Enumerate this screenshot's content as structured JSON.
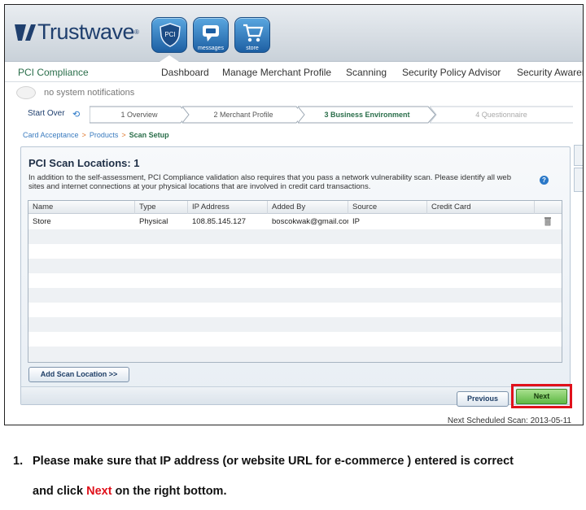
{
  "header": {
    "brand": "Trustwave",
    "brand_mark": "®",
    "pci_label": "PCI",
    "messages_label": "messages",
    "store_label": "store"
  },
  "nav": {
    "title": "PCI Compliance",
    "items": [
      "Dashboard",
      "Manage Merchant Profile",
      "Scanning",
      "Security Policy Advisor",
      "Security Awarer"
    ]
  },
  "notifications": "no system notifications",
  "wizard": {
    "start_over": "Start Over",
    "steps": [
      {
        "label": "1  Overview",
        "state": "done"
      },
      {
        "label": "2  Merchant Profile",
        "state": "done"
      },
      {
        "label": "3  Business Environment",
        "state": "active"
      },
      {
        "label": "4  Questionnaire",
        "state": "disabled"
      }
    ]
  },
  "breadcrumb": {
    "items": [
      "Card Acceptance",
      "Products"
    ],
    "current": "Scan Setup",
    "separator": ">"
  },
  "panel": {
    "title": "PCI Scan Locations: 1",
    "description": "In addition to the self-assessment, PCI Compliance validation also requires that you pass a network vulnerability scan.  Please identify all web sites and internet connections at your physical locations that are involved in credit card transactions.",
    "help": "?"
  },
  "grid": {
    "columns": [
      "Name",
      "Type",
      "IP Address",
      "Added By",
      "Source",
      "Credit Card"
    ],
    "rows": [
      {
        "name": "Store",
        "type": "Physical",
        "ip": "108.85.145.127",
        "added_by": "boscokwak@gmail.com",
        "source": "IP",
        "credit_card": ""
      }
    ]
  },
  "buttons": {
    "add_scan": "Add Scan Location >>",
    "previous": "Previous",
    "next": "Next"
  },
  "next_scheduled": "Next Scheduled Scan: 2013-05-11",
  "instruction": {
    "number": "1.",
    "line1": "Please make sure that IP address (or website URL for e-commerce ) entered is correct",
    "line2_pre": "and click ",
    "line2_highlight": "Next",
    "line2_post": " on the right bottom."
  },
  "colors": {
    "brand_navy": "#1f3f6e",
    "accent_green": "#2a6e4a",
    "highlight_red": "#e0111b"
  }
}
